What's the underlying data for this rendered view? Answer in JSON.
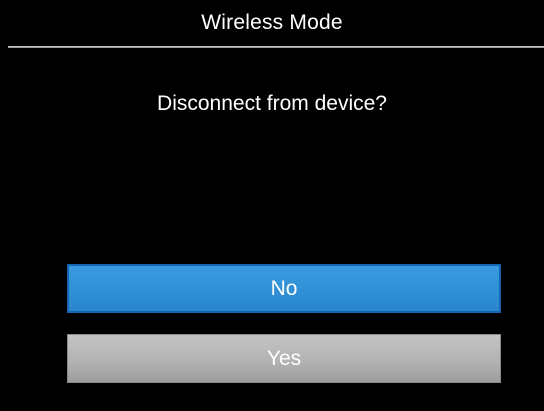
{
  "dialog": {
    "title": "Wireless Mode",
    "prompt": "Disconnect from device?",
    "options": [
      {
        "label": "No",
        "state": "selected",
        "color": "#3193da"
      },
      {
        "label": "Yes",
        "state": "unselected",
        "color": "#b3b3b3"
      }
    ]
  },
  "colors": {
    "background": "#000000",
    "text": "#ffffff",
    "divider": "#b0b0b0"
  }
}
